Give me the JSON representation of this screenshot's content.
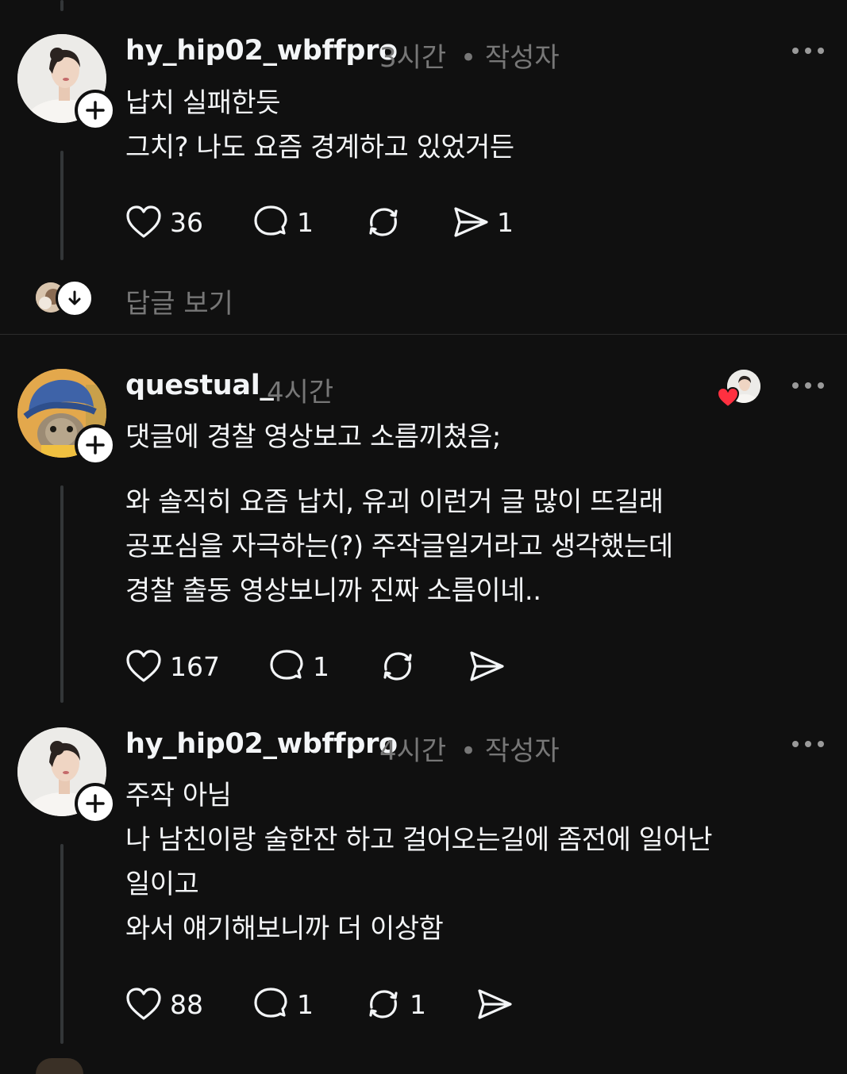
{
  "posts": [
    {
      "username": "hy_hip02_wbffpro",
      "time": "3시간",
      "author_tag": "• 작성자",
      "lines": [
        "납치 실패한듯",
        "그치? 나도 요즘 경계하고 있었거든"
      ],
      "likes": "36",
      "replies": "1",
      "reposts": "",
      "shares": "1"
    },
    {
      "username": "questual_",
      "time": "4시간",
      "author_tag": "",
      "lines": [
        "댓글에 경찰 영상보고 소름끼쳤음;",
        "",
        "와 솔직히 요즘 납치, 유괴 이런거 글 많이 뜨길래",
        "공포심을 자극하는(?) 주작글일거라고 생각했는데",
        "경찰 출동 영상보니까 진짜 소름이네.."
      ],
      "likes": "167",
      "replies": "1",
      "reposts": "",
      "shares": ""
    },
    {
      "username": "hy_hip02_wbffpro",
      "time": "4시간",
      "author_tag": "• 작성자",
      "lines": [
        "주작 아님",
        "나 남친이랑 술한잔 하고 걸어오는길에 좀전에 일어난",
        "일이고",
        "와서 얘기해보니까 더 이상함"
      ],
      "likes": "88",
      "replies": "1",
      "reposts": "1",
      "shares": ""
    }
  ],
  "view_replies_label": "답글 보기",
  "colors": {
    "background": "#101010",
    "text": "#f3f5f7",
    "muted": "#777777",
    "heart": "#ff3040"
  }
}
